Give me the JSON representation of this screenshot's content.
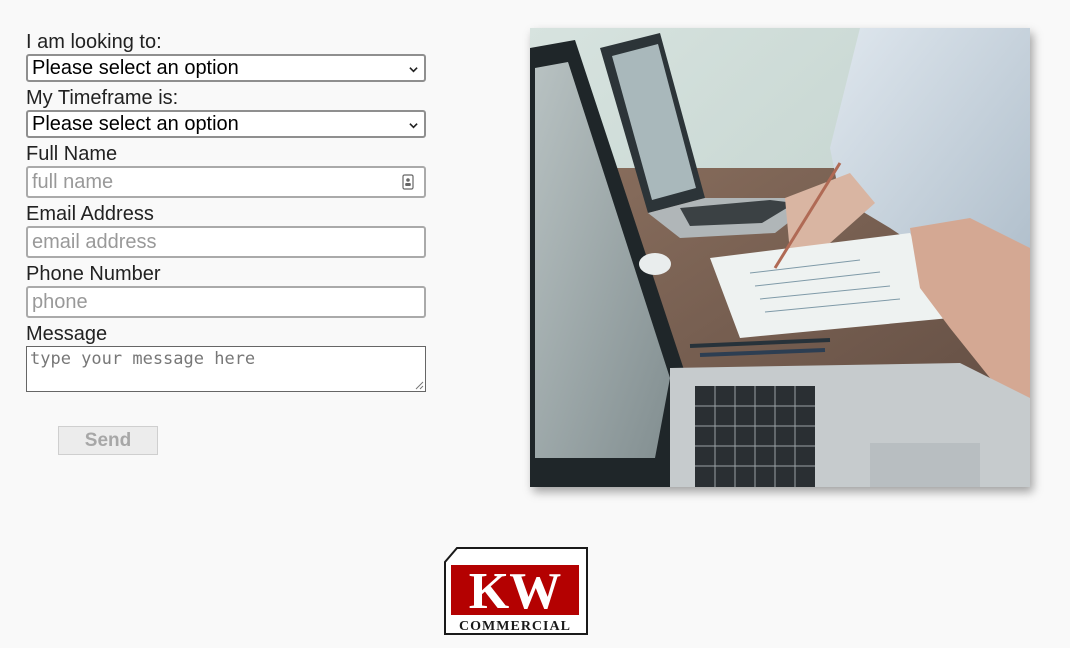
{
  "form": {
    "looking_label": "I am looking to:",
    "looking_value": "Please select an option",
    "timeframe_label": "My Timeframe is:",
    "timeframe_value": "Please select an option",
    "name_label": "Full Name",
    "name_placeholder": "full name",
    "email_label": "Email Address",
    "email_placeholder": "email address",
    "phone_label": "Phone Number",
    "phone_placeholder": "phone",
    "message_label": "Message",
    "message_placeholder": "type your message here",
    "send_label": "Send"
  },
  "logo": {
    "letters": "KW",
    "word": "COMMERCIAL",
    "brand_color": "#b40101"
  },
  "icons": [
    "chevron-down-icon",
    "contact-card-icon",
    "resize-grip-icon"
  ],
  "colors": {
    "background": "#f9f9f9",
    "button_background": "#ececec",
    "button_text": "#a7a7a7"
  }
}
